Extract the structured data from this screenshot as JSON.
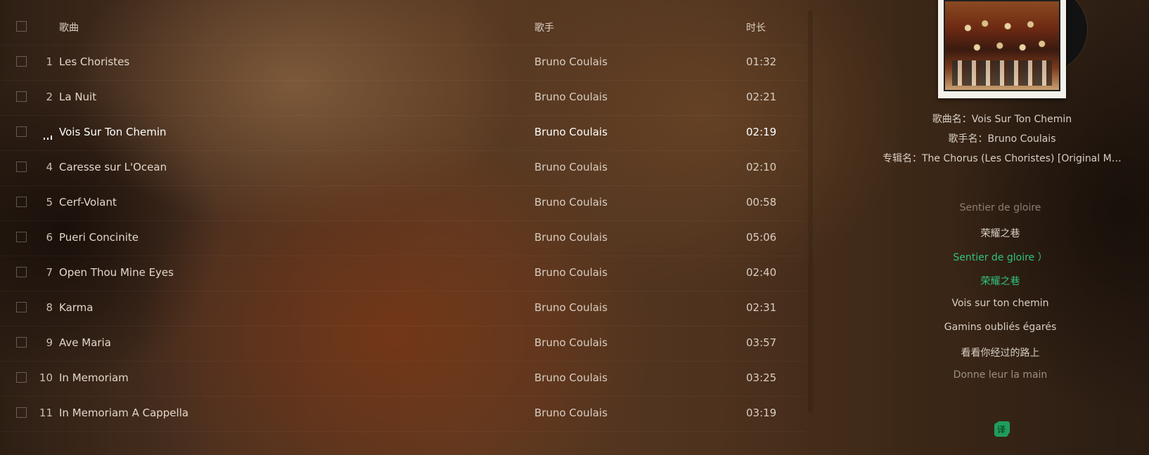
{
  "table": {
    "header": {
      "title": "歌曲",
      "artist": "歌手",
      "duration": "时长"
    },
    "rows": [
      {
        "num": "1",
        "title": "Les Choristes",
        "artist": "Bruno Coulais",
        "duration": "01:32"
      },
      {
        "num": "2",
        "title": "La Nuit",
        "artist": "Bruno Coulais",
        "duration": "02:21"
      },
      {
        "num": "",
        "title": "Vois Sur Ton Chemin",
        "artist": "Bruno Coulais",
        "duration": "02:19"
      },
      {
        "num": "4",
        "title": "Caresse sur L'Ocean",
        "artist": "Bruno Coulais",
        "duration": "02:10"
      },
      {
        "num": "5",
        "title": "Cerf-Volant",
        "artist": "Bruno Coulais",
        "duration": "00:58"
      },
      {
        "num": "6",
        "title": "Pueri Concinite",
        "artist": "Bruno Coulais",
        "duration": "05:06"
      },
      {
        "num": "7",
        "title": "Open Thou Mine Eyes",
        "artist": "Bruno Coulais",
        "duration": "02:40"
      },
      {
        "num": "8",
        "title": "Karma",
        "artist": "Bruno Coulais",
        "duration": "02:31"
      },
      {
        "num": "9",
        "title": "Ave Maria",
        "artist": "Bruno Coulais",
        "duration": "03:57"
      },
      {
        "num": "10",
        "title": "In Memoriam",
        "artist": "Bruno Coulais",
        "duration": "03:25"
      },
      {
        "num": "11",
        "title": "In Memoriam A Cappella",
        "artist": "Bruno Coulais",
        "duration": "03:19"
      }
    ],
    "playing_index": 2
  },
  "info": {
    "song": "歌曲名：Vois Sur Ton Chemin",
    "singer": "歌手名：Bruno Coulais",
    "album": "专辑名：The Chorus (Les Choristes) [Original Mu..."
  },
  "lyrics": [
    "Sentier de gloire",
    "荣耀之巷",
    "Sentier de gloire ）",
    "荣耀之巷",
    "Vois sur ton chemin",
    "Gamins oubliés égarés",
    "看看你经过的路上",
    "Donne leur la main"
  ],
  "translate_button": "译",
  "colors": {
    "current_lyric": "#31c27c",
    "accent": "#1f9d5a"
  }
}
